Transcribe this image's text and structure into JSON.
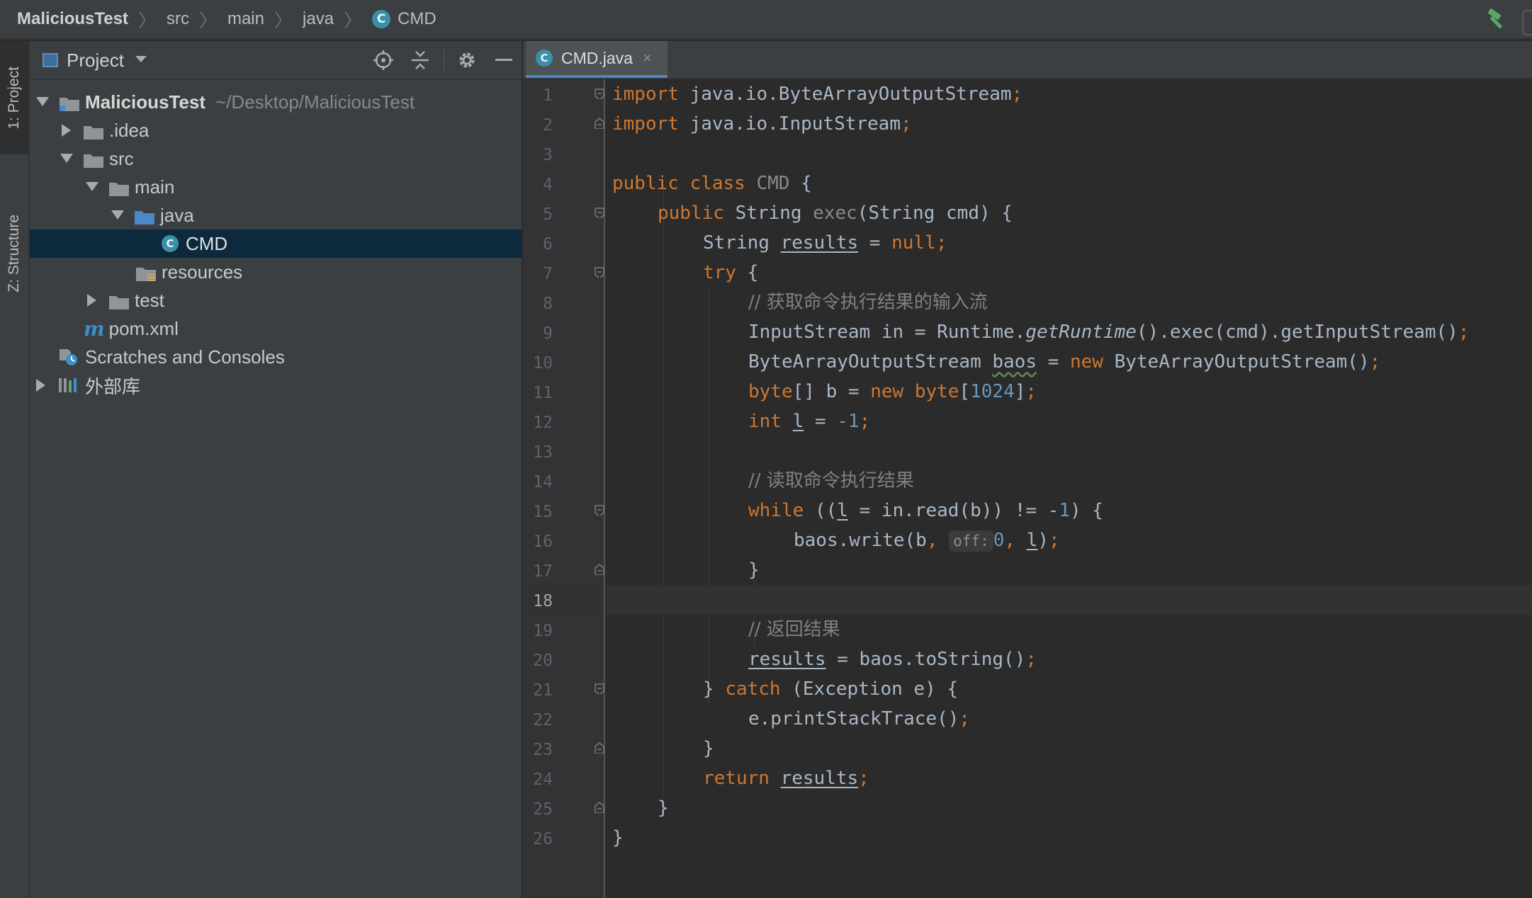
{
  "breadcrumb": {
    "items": [
      "MaliciousTest",
      "src",
      "main",
      "java",
      "CMD"
    ],
    "separator": "〉",
    "class_icon_letter": "C"
  },
  "toolbar": {
    "build_icon": "hammer-icon"
  },
  "tool_strip": {
    "project_tab": "1: Project",
    "structure_tab": "Z: Structure"
  },
  "project_panel": {
    "title": "Project",
    "root": {
      "name": "MaliciousTest",
      "path": "~/Desktop/MaliciousTest"
    },
    "tree": [
      {
        "label": ".idea"
      },
      {
        "label": "src"
      },
      {
        "label": "main"
      },
      {
        "label": "java"
      },
      {
        "label": "CMD"
      },
      {
        "label": "resources"
      },
      {
        "label": "test"
      },
      {
        "label": "pom.xml"
      },
      {
        "label": "Scratches and Consoles"
      },
      {
        "label": "外部库"
      }
    ]
  },
  "editor": {
    "tab_label": "CMD.java",
    "tab_close": "×",
    "current_line": 18,
    "param_hint": "off:"
  },
  "colors": {
    "keyword": "#cc7832",
    "text": "#a9b7c6",
    "comment": "#808080",
    "number": "#6897bb",
    "selection": "#0d293e",
    "class_icon": "#3a90a8"
  },
  "code_lines": [
    [
      "import",
      " java.io.ByteArrayOutputStream",
      ";"
    ],
    [
      "import",
      " java.io.InputStream",
      ";"
    ],
    [],
    [
      "public class",
      " ",
      "CMD",
      " {"
    ],
    [
      "public",
      " String ",
      "exec",
      "(String cmd) {"
    ],
    [
      "String ",
      "results",
      " = ",
      "null",
      ";"
    ],
    [
      "try",
      " {"
    ],
    [
      "// 获取命令执行结果的输入流"
    ],
    [
      "InputStream in = Runtime.",
      "getRuntime",
      "().exec(cmd).getInputStream()",
      ";"
    ],
    [
      "ByteArrayOutputStream ",
      "baos",
      " = ",
      "new",
      " ByteArrayOutputStream()",
      ";"
    ],
    [
      "byte",
      "[] b = ",
      "new",
      " ",
      "byte",
      "[",
      "1024",
      "]",
      ";"
    ],
    [
      "int",
      " ",
      "l",
      " = ",
      "-1",
      ";"
    ],
    [],
    [
      "// 读取命令执行结果"
    ],
    [
      "while",
      " ((",
      "l",
      " = in.read(b)) != -",
      "1",
      ") {"
    ],
    [
      "baos.write(b",
      ",",
      " ",
      "0",
      ", ",
      "l",
      ")",
      ";"
    ],
    [
      "}"
    ],
    [],
    [
      "// 返回结果"
    ],
    [
      "results",
      " = baos.toString()",
      ";"
    ],
    [
      "} ",
      "catch",
      " (Exception e) {"
    ],
    [
      "e.printStackTrace()",
      ";"
    ],
    [
      "}"
    ],
    [
      "return",
      " ",
      "results",
      ";"
    ],
    [
      "}"
    ],
    [
      "}"
    ]
  ],
  "line_numbers": [
    "1",
    "2",
    "3",
    "4",
    "5",
    "6",
    "7",
    "8",
    "9",
    "10",
    "11",
    "12",
    "13",
    "14",
    "15",
    "16",
    "17",
    "18",
    "19",
    "20",
    "21",
    "22",
    "23",
    "24",
    "25",
    "26"
  ]
}
